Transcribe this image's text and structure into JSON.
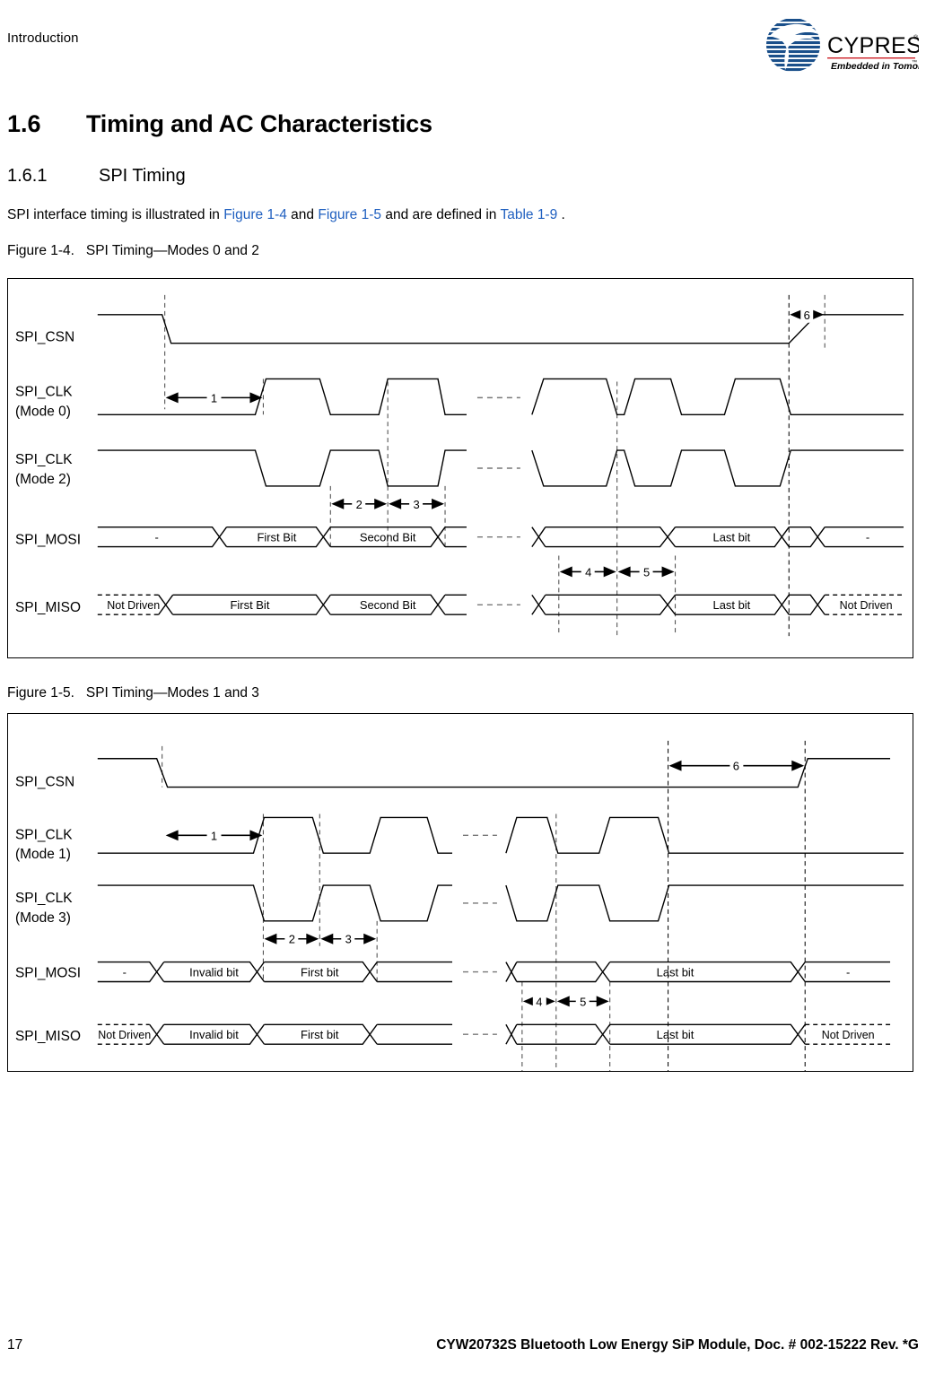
{
  "header": {
    "chapter": "Introduction",
    "logo": {
      "wordmark": "CYPRESS",
      "tagline": "Embedded in Tomorrow",
      "registered": "®",
      "trademark": "™",
      "globe_color": "#1a4f8a",
      "wordmark_color": "#1a4f8a",
      "tagline_color": "#cc2027"
    }
  },
  "headings": {
    "section_number": "1.6",
    "section_title": "Timing and AC Characteristics",
    "subsection_number": "1.6.1",
    "subsection_title": "SPI Timing"
  },
  "body": {
    "intro_pre": "SPI interface timing is illustrated in ",
    "xref_fig1": "Figure 1-4",
    "intro_mid": " and ",
    "xref_fig2": "Figure 1-5",
    "intro_mid2": " and are defined in ",
    "xref_table": "Table 1-9",
    "intro_post": " ."
  },
  "figures": [
    {
      "caption_label": "Figure 1-4.",
      "caption_text": "SPI Timing—Modes 0 and 2",
      "signals": [
        {
          "name": "SPI_CSN",
          "mode": ""
        },
        {
          "name": "SPI_CLK",
          "mode": "(Mode 0)"
        },
        {
          "name": "SPI_CLK",
          "mode": "(Mode 2)"
        },
        {
          "name": "SPI_MOSI",
          "mode": ""
        },
        {
          "name": "SPI_MISO",
          "mode": ""
        }
      ],
      "mosi_cells": [
        "-",
        "First Bit",
        "Second Bit",
        "Last bit",
        "-"
      ],
      "miso_cells": [
        "Not Driven",
        "First Bit",
        "Second Bit",
        "Last bit",
        "Not Driven"
      ],
      "markers": [
        "1",
        "2",
        "3",
        "4",
        "5",
        "6"
      ]
    },
    {
      "caption_label": "Figure 1-5.",
      "caption_text": "SPI Timing—Modes 1 and 3",
      "signals": [
        {
          "name": "SPI_CSN",
          "mode": ""
        },
        {
          "name": "SPI_CLK",
          "mode": "(Mode 1)"
        },
        {
          "name": "SPI_CLK",
          "mode": "(Mode 3)"
        },
        {
          "name": "SPI_MOSI",
          "mode": ""
        },
        {
          "name": "SPI_MISO",
          "mode": ""
        }
      ],
      "mosi_cells": [
        "-",
        "Invalid bit",
        "First bit",
        "Last bit",
        "-"
      ],
      "miso_cells": [
        "Not Driven",
        "Invalid bit",
        "First bit",
        "Last bit",
        "Not Driven"
      ],
      "markers": [
        "1",
        "2",
        "3",
        "4",
        "5",
        "6"
      ]
    }
  ],
  "footer": {
    "page_number": "17",
    "document": "CYW20732S Bluetooth Low Energy SiP Module, Doc. # 002-15222 Rev. *G"
  }
}
